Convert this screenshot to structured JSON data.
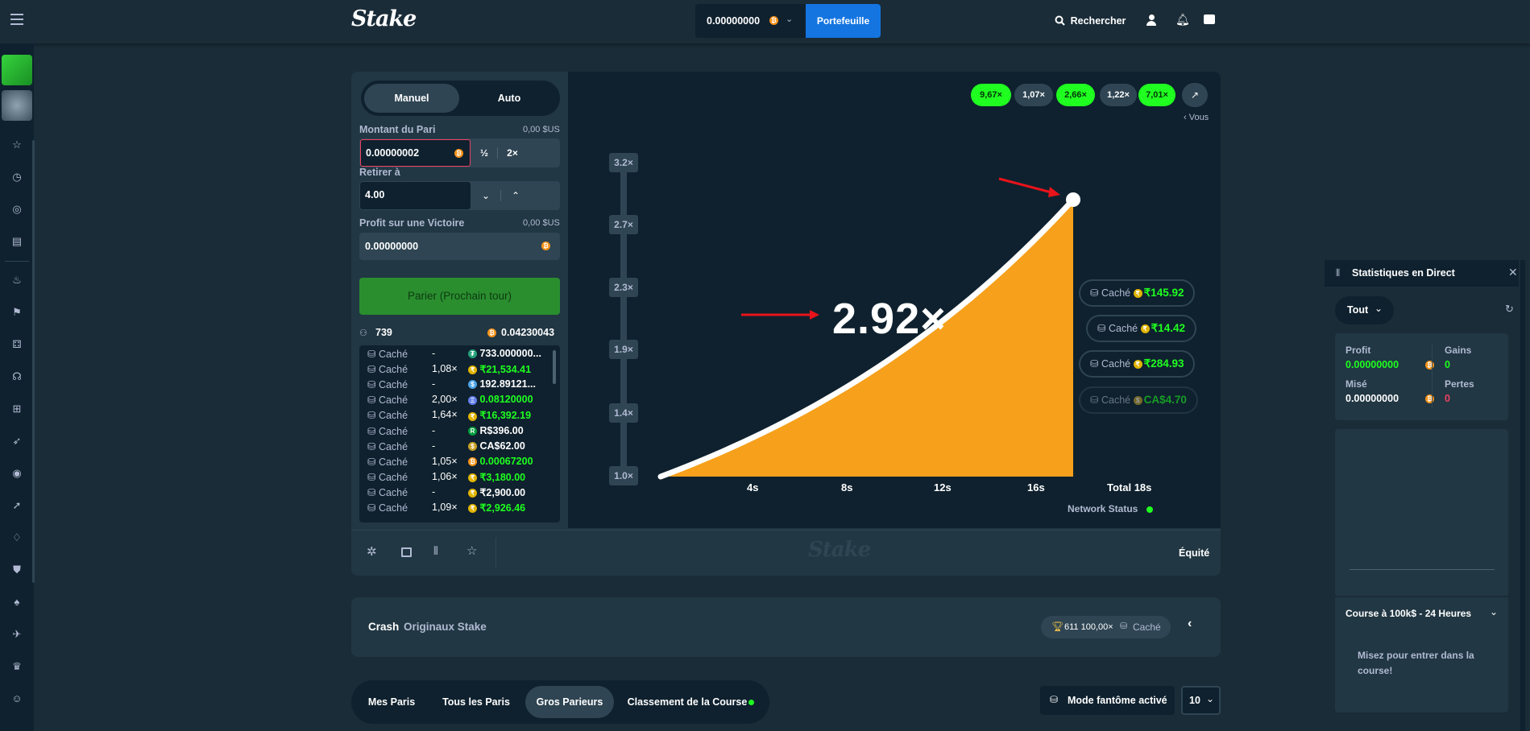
{
  "header": {
    "logo": "Stake",
    "balance": "0.00000000",
    "wallet_button": "Portefeuille",
    "search_label": "Rechercher"
  },
  "bet_panel": {
    "tab_manual": "Manuel",
    "tab_auto": "Auto",
    "bet_amount_label": "Montant du Pari",
    "bet_amount_usd": "0,00 $US",
    "bet_amount_value": "0.00000002",
    "half_label": "½",
    "double_label": "2×",
    "cashout_label": "Retirer à",
    "cashout_value": "4.00",
    "profit_label": "Profit sur une Victoire",
    "profit_usd": "0,00 $US",
    "profit_value": "0.00000000",
    "bet_button": "Parier (Prochain tour)",
    "players_count": "739",
    "total_pot": "0.04230043"
  },
  "live_bets": [
    {
      "user": "Caché",
      "mult": "-",
      "amount": "733.000000...",
      "coin": "teal",
      "color": "white"
    },
    {
      "user": "Caché",
      "mult": "1,08×",
      "amount": "₹21,534.41",
      "coin": "rupee",
      "color": "green"
    },
    {
      "user": "Caché",
      "mult": "-",
      "amount": "192.89121...",
      "coin": "blue",
      "color": "white"
    },
    {
      "user": "Caché",
      "mult": "2,00×",
      "amount": "0.08120000",
      "coin": "purple",
      "color": "green"
    },
    {
      "user": "Caché",
      "mult": "1,64×",
      "amount": "₹16,392.19",
      "coin": "rupee",
      "color": "green"
    },
    {
      "user": "Caché",
      "mult": "-",
      "amount": "R$396.00",
      "coin": "brl",
      "color": "white"
    },
    {
      "user": "Caché",
      "mult": "-",
      "amount": "CA$62.00",
      "coin": "cad",
      "color": "white"
    },
    {
      "user": "Caché",
      "mult": "1,05×",
      "amount": "0.00067200",
      "coin": "btc",
      "color": "green"
    },
    {
      "user": "Caché",
      "mult": "1,06×",
      "amount": "₹3,180.00",
      "coin": "rupee",
      "color": "green"
    },
    {
      "user": "Caché",
      "mult": "-",
      "amount": "₹2,900.00",
      "coin": "rupee",
      "color": "white"
    },
    {
      "user": "Caché",
      "mult": "1,09×",
      "amount": "₹2,926.46",
      "coin": "rupee",
      "color": "green"
    }
  ],
  "history": [
    {
      "label": "9,67×",
      "win": true
    },
    {
      "label": "1,07×",
      "win": false
    },
    {
      "label": "2,66×",
      "win": true
    },
    {
      "label": "1,22×",
      "win": false
    },
    {
      "label": "7,01×",
      "win": true
    }
  ],
  "history_more": "‹ Vous",
  "chart_data": {
    "type": "area",
    "current_multiplier": "2.92×",
    "y_ticks": [
      "1.0×",
      "1.4×",
      "1.9×",
      "2.3×",
      "2.7×",
      "3.2×"
    ],
    "x_ticks": [
      "4s",
      "8s",
      "12s",
      "16s"
    ],
    "total_label": "Total 18s",
    "curve_end": {
      "x_seconds": 18,
      "y": 2.92
    },
    "fill_color": "#f6a01b"
  },
  "network_status": "Network Status",
  "cashouts": [
    {
      "user": "Caché",
      "amount": "₹145.92",
      "coin": "rupee",
      "dim": false
    },
    {
      "user": "Caché",
      "amount": "₹14.42",
      "coin": "rupee",
      "dim": false
    },
    {
      "user": "Caché",
      "amount": "₹284.93",
      "coin": "rupee",
      "dim": false
    },
    {
      "user": "Caché",
      "amount": "CA$4.70",
      "coin": "cad",
      "dim": true
    }
  ],
  "footer_bar": {
    "watermark": "Stake",
    "fairness": "Équité"
  },
  "game_info": {
    "title": "Crash",
    "subtitle": "Originaux Stake",
    "record": "611 100,00×",
    "record_user": "Caché"
  },
  "bottom_tabs": {
    "my_bets": "Mes Paris",
    "all_bets": "Tous les Paris",
    "high_rollers": "Gros Parieurs",
    "race": "Classement de la Course",
    "ghost_mode": "Mode fantôme activé",
    "page_size": "10"
  },
  "live_stats": {
    "title": "Statistiques en Direct",
    "filter": "Tout",
    "profit_label": "Profit",
    "profit_value": "0.00000000",
    "wins_label": "Gains",
    "wins_value": "0",
    "wagered_label": "Misé",
    "wagered_value": "0.00000000",
    "losses_label": "Pertes",
    "losses_value": "0",
    "race_title": "Course à 100k$ - 24 Heures",
    "race_text": "Misez pour entrer dans la course!"
  }
}
